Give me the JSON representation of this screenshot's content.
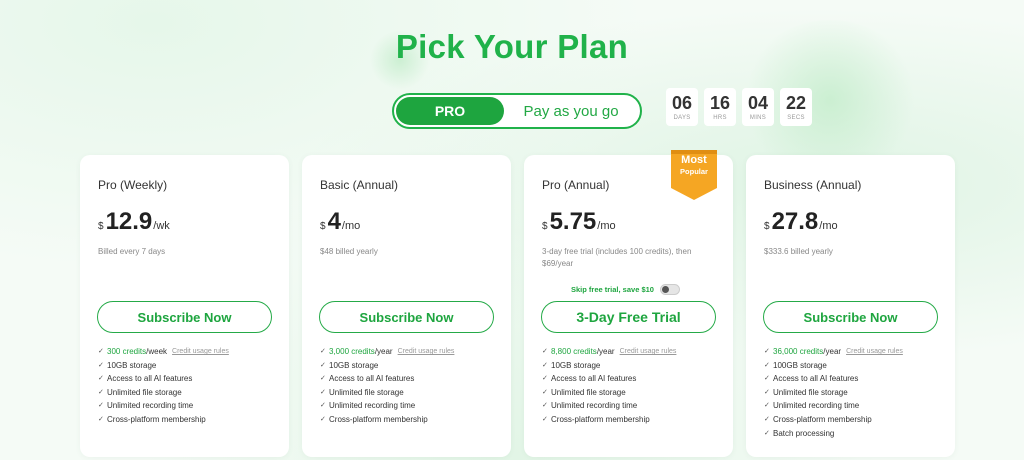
{
  "header": {
    "title": "Pick Your Plan"
  },
  "toggle": {
    "active": "PRO",
    "inactive": "Pay as you go"
  },
  "countdown": [
    {
      "value": "06",
      "label": "DAYS"
    },
    {
      "value": "16",
      "label": "HRS"
    },
    {
      "value": "04",
      "label": "MINS"
    },
    {
      "value": "22",
      "label": "SECS"
    }
  ],
  "plans": [
    {
      "name": "Pro (Weekly)",
      "currency": "$",
      "amount": "12.9",
      "unit": "/wk",
      "billed": "Billed every 7 days",
      "cta": "Subscribe Now",
      "credits": "300 credits",
      "credits_period": "/week",
      "rules": "Credit usage rules",
      "features": [
        "10GB storage",
        "Access to all AI features",
        "Unlimited file storage",
        "Unlimited recording time",
        "Cross-platform membership"
      ]
    },
    {
      "name": "Basic (Annual)",
      "currency": "$",
      "amount": "4",
      "unit": "/mo",
      "billed": "$48 billed yearly",
      "cta": "Subscribe Now",
      "credits": "3,000 credits",
      "credits_period": "/year",
      "rules": "Credit usage rules",
      "features": [
        "10GB storage",
        "Access to all AI features",
        "Unlimited file storage",
        "Unlimited recording time",
        "Cross-platform membership"
      ]
    },
    {
      "name": "Pro (Annual)",
      "currency": "$",
      "amount": "5.75",
      "unit": "/mo",
      "billed": "3-day free trial (includes 100 credits), then $69/year",
      "cta": "3-Day Free Trial",
      "badge_line1": "Most",
      "badge_line2": "Popular",
      "skip_label": "Skip free trial, save $10",
      "skip_enabled": false,
      "credits": "8,800 credits",
      "credits_period": "/year",
      "rules": "Credit usage rules",
      "features": [
        "10GB storage",
        "Access to all AI features",
        "Unlimited file storage",
        "Unlimited recording time",
        "Cross-platform membership"
      ]
    },
    {
      "name": "Business (Annual)",
      "currency": "$",
      "amount": "27.8",
      "unit": "/mo",
      "billed": "$333.6 billed yearly",
      "cta": "Subscribe Now",
      "credits": "36,000 credits",
      "credits_period": "/year",
      "rules": "Credit usage rules",
      "features": [
        "100GB storage",
        "Access to all AI features",
        "Unlimited file storage",
        "Unlimited recording time",
        "Cross-platform membership",
        "Batch processing"
      ]
    }
  ],
  "colors": {
    "accent": "#1ea53f",
    "title": "#20b24a",
    "badge": "#f5a623"
  }
}
